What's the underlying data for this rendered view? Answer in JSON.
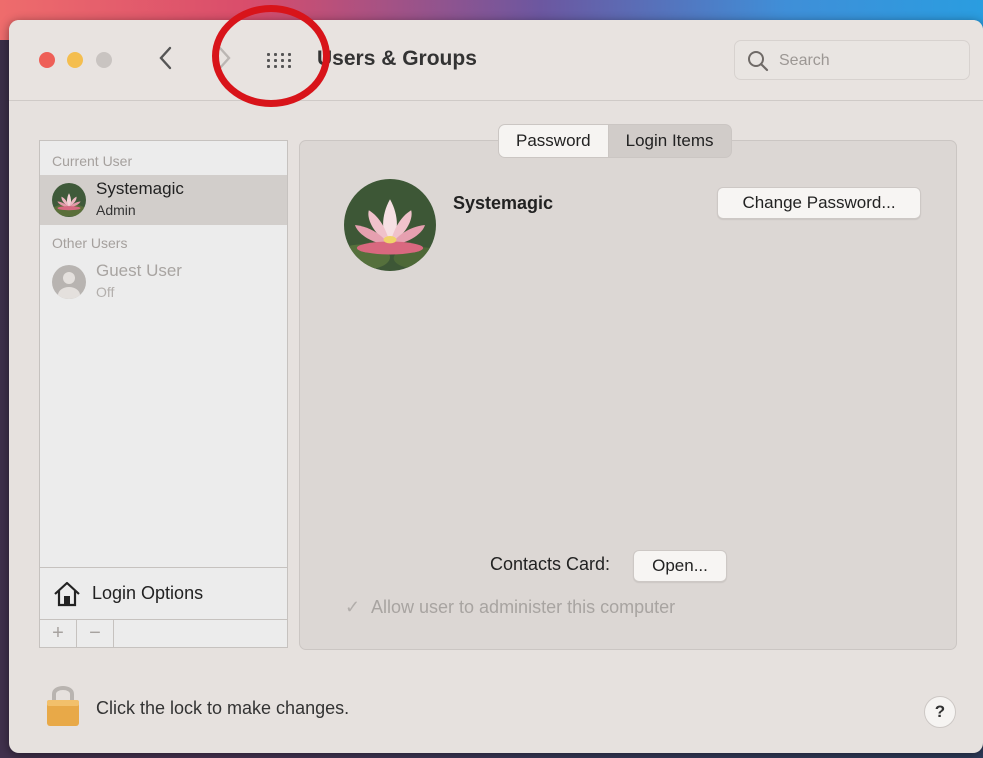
{
  "window": {
    "title": "Users & Groups",
    "search_placeholder": "Search"
  },
  "sidebar": {
    "current_user_header": "Current User",
    "current_user": {
      "name": "Systemagic",
      "role": "Admin"
    },
    "other_users_header": "Other Users",
    "other_users": [
      {
        "name": "Guest User",
        "status": "Off"
      }
    ],
    "login_options_label": "Login Options",
    "add_label": "+",
    "remove_label": "−"
  },
  "tabs": [
    {
      "label": "Password",
      "active": true
    },
    {
      "label": "Login Items",
      "active": false
    }
  ],
  "main": {
    "user_name": "Systemagic",
    "change_password_label": "Change Password...",
    "contacts_card_label": "Contacts Card:",
    "open_label": "Open...",
    "allow_admin_label": "Allow user to administer this computer",
    "allow_admin_checked": true
  },
  "footer": {
    "lock_text": "Click the lock to make changes.",
    "help_label": "?"
  },
  "icons": {
    "back": "chevron-left-icon",
    "forward": "chevron-right-icon",
    "grid": "grid-icon",
    "search": "search-icon",
    "home": "house-icon",
    "lock": "lock-icon"
  },
  "colors": {
    "close": "#ee5f57",
    "minimize": "#f4be4f",
    "annotation_circle": "#d8141a"
  }
}
